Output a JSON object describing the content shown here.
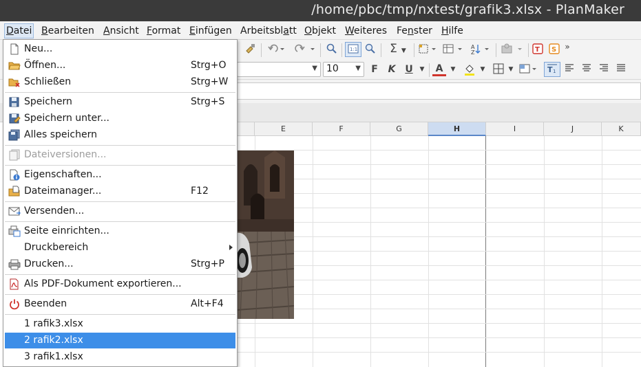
{
  "window": {
    "title": "/home/pbc/tmp/nxtest/grafik3.xlsx - PlanMaker"
  },
  "menubar": {
    "items": [
      {
        "label": "Datei",
        "accel": "D",
        "rest": "atei"
      },
      {
        "label": "Bearbeiten",
        "accel": "B",
        "rest": "earbeiten"
      },
      {
        "label": "Ansicht",
        "accel": "A",
        "rest": "nsicht"
      },
      {
        "label": "Format",
        "accel": "F",
        "rest": "ormat"
      },
      {
        "label": "Einfügen",
        "accel": "E",
        "rest": "infügen"
      },
      {
        "label": "Arbeitsblatt",
        "pre": "Arbeitsbl",
        "accel": "a",
        "rest": "tt"
      },
      {
        "label": "Objekt",
        "accel": "O",
        "rest": "bjekt"
      },
      {
        "label": "Weiteres",
        "accel": "W",
        "rest": "eiteres"
      },
      {
        "label": "Fenster",
        "pre": "Fe",
        "accel": "n",
        "rest": "ster"
      },
      {
        "label": "Hilfe",
        "accel": "H",
        "rest": "ilfe"
      }
    ]
  },
  "toolbar": {
    "font_size": "10",
    "bold": "F",
    "italic": "K",
    "underline": "U",
    "font_color": "A",
    "more": "»",
    "sum": "Σ"
  },
  "sheet": {
    "columns": [
      "E",
      "F",
      "G",
      "H",
      "I",
      "J",
      "K"
    ],
    "selected_column": "H"
  },
  "file_menu": {
    "items": [
      {
        "label": "Neu...",
        "shortcut": ""
      },
      {
        "label": "Öffnen...",
        "shortcut": "Strg+O"
      },
      {
        "label": "Schließen",
        "shortcut": "Strg+W"
      },
      {
        "label": "Speichern",
        "shortcut": "Strg+S"
      },
      {
        "label": "Speichern unter...",
        "shortcut": ""
      },
      {
        "label": "Alles speichern",
        "shortcut": ""
      },
      {
        "label": "Dateiversionen...",
        "shortcut": "",
        "disabled": true
      },
      {
        "label": "Eigenschaften...",
        "shortcut": ""
      },
      {
        "label": "Dateimanager...",
        "shortcut": "F12"
      },
      {
        "label": "Versenden...",
        "shortcut": ""
      },
      {
        "label": "Seite einrichten...",
        "shortcut": ""
      },
      {
        "label": "Druckbereich",
        "shortcut": "",
        "submenu": true
      },
      {
        "label": "Drucken...",
        "shortcut": "Strg+P"
      },
      {
        "label": "Als PDF-Dokument exportieren...",
        "shortcut": ""
      },
      {
        "label": "Beenden",
        "shortcut": "Alt+F4"
      },
      {
        "label": "1 rafik3.xlsx",
        "shortcut": ""
      },
      {
        "label": "2 rafik2.xlsx",
        "shortcut": "",
        "highlighted": true
      },
      {
        "label": "3 rafik1.xlsx",
        "shortcut": ""
      }
    ]
  },
  "colors": {
    "titlebar": "#3a3a3a",
    "highlight": "#3d8ee8",
    "selected_column": "#cddcf1"
  }
}
